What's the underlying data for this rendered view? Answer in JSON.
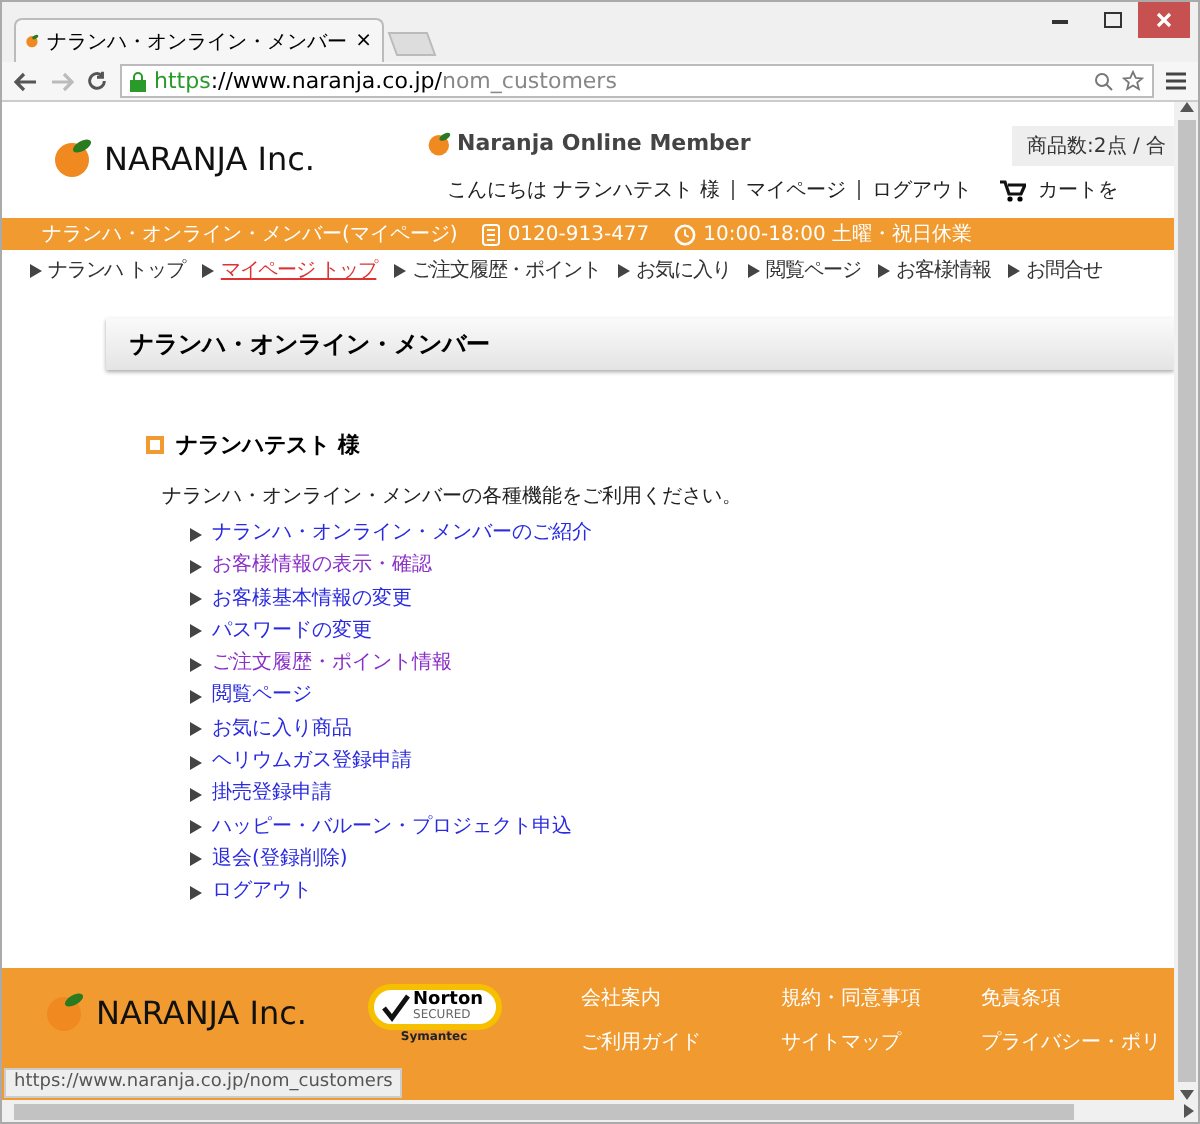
{
  "browser": {
    "tab_title": "ナランハ・オンライン・メンバー",
    "tab_close": "×",
    "url_scheme": "https",
    "url_host": "://www.naranja.co.jp/",
    "url_path": "nom_customers"
  },
  "header": {
    "logo": "NARANJA Inc.",
    "member_logo": "Naranja Online Member",
    "cart_summary": "商品数:2点 / 合",
    "greeting": "こんにちは ナランハテスト 様",
    "links": [
      "マイページ",
      "ログアウト"
    ],
    "cart_link": "カートを"
  },
  "info_bar": {
    "title": "ナランハ・オンライン・メンバー(マイページ)",
    "phone": "0120-913-477",
    "hours": "10:00-18:00 土曜・祝日休業"
  },
  "nav": [
    {
      "label": "ナランハ トップ",
      "selected": false
    },
    {
      "label": "マイページ トップ",
      "selected": true
    },
    {
      "label": "ご注文履歴・ポイント",
      "selected": false
    },
    {
      "label": "お気に入り",
      "selected": false
    },
    {
      "label": "閲覧ページ",
      "selected": false
    },
    {
      "label": "お客様情報",
      "selected": false
    },
    {
      "label": "お問合せ",
      "selected": false
    }
  ],
  "page_title": "ナランハ・オンライン・メンバー",
  "user_heading": "ナランハテスト 様",
  "intro": "ナランハ・オンライン・メンバーの各種機能をご利用ください。",
  "menu": [
    {
      "label": "ナランハ・オンライン・メンバーのご紹介",
      "visited": false
    },
    {
      "label": "お客様情報の表示・確認",
      "visited": true
    },
    {
      "label": "お客様基本情報の変更",
      "visited": false
    },
    {
      "label": "パスワードの変更",
      "visited": false
    },
    {
      "label": "ご注文履歴・ポイント情報",
      "visited": true
    },
    {
      "label": "閲覧ページ",
      "visited": false
    },
    {
      "label": "お気に入り商品",
      "visited": false
    },
    {
      "label": "ヘリウムガス登録申請",
      "visited": false
    },
    {
      "label": "掛売登録申請",
      "visited": false
    },
    {
      "label": "ハッピー・バルーン・プロジェクト申込",
      "visited": false
    },
    {
      "label": "退会(登録削除)",
      "visited": false
    },
    {
      "label": "ログアウト",
      "visited": false
    }
  ],
  "footer": {
    "logo": "NARANJA Inc.",
    "badge": "Norton",
    "badge_sub": "SECURED",
    "badge_vendor": "Symantec",
    "links": [
      "会社案内",
      "規約・同意事項",
      "免責条項",
      "ご利用ガイド",
      "サイトマップ",
      "プライバシー・ポリ"
    ]
  },
  "status_url": "https://www.naranja.co.jp/nom_customers"
}
